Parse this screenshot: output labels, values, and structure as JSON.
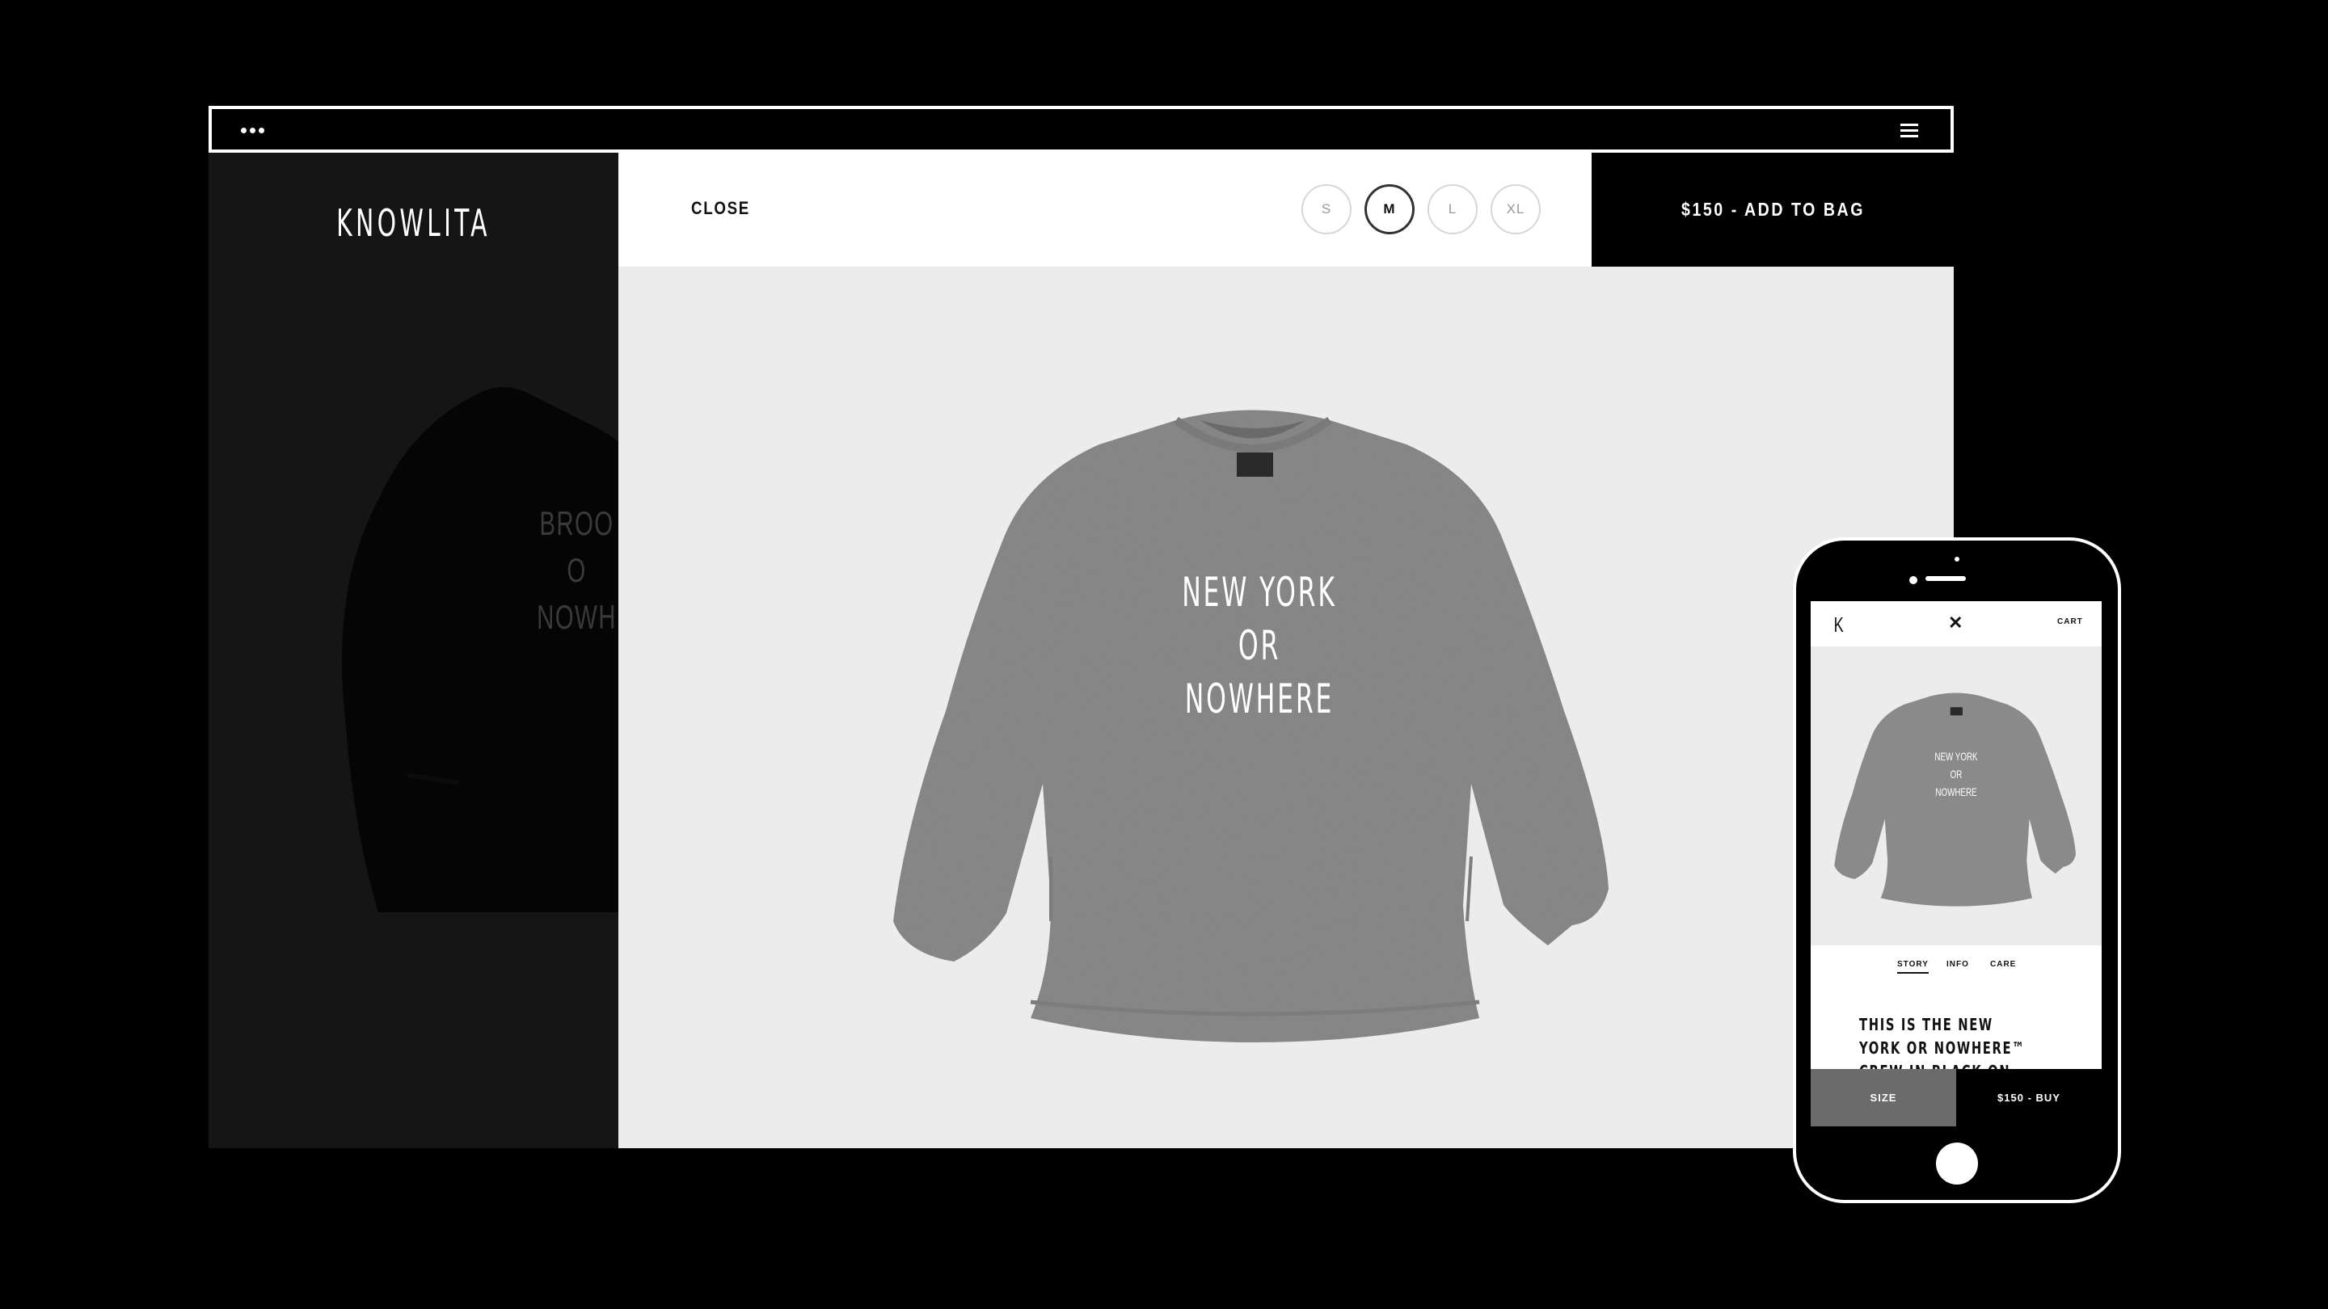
{
  "brand": {
    "name": "KNOWLITA"
  },
  "background_sweater": {
    "text_lines": [
      "BROO",
      "O",
      "NOWH"
    ]
  },
  "product_header": {
    "close_label": "CLOSE",
    "sizes": [
      "S",
      "M",
      "L",
      "XL"
    ],
    "selected_size": "M",
    "add_to_bag_label": "$150 - ADD TO BAG"
  },
  "product": {
    "print_lines": [
      "NEW YORK",
      "OR",
      "NOWHERE"
    ],
    "sweater_color": "#8a8a8a"
  },
  "phone": {
    "logo": "K",
    "close_icon": "close-icon",
    "cart_label": "CART",
    "tabs": [
      "STORY",
      "INFO",
      "CARE"
    ],
    "active_tab": "STORY",
    "story_text": "THIS IS THE NEW YORK OR NOWHERE™ CREW IN BLACK ON GREY. NYON",
    "size_label": "SIZE",
    "buy_label": "$150 - BUY"
  },
  "colors": {
    "accent": "#000000",
    "stage": "#ececec",
    "panel": "#151515"
  }
}
